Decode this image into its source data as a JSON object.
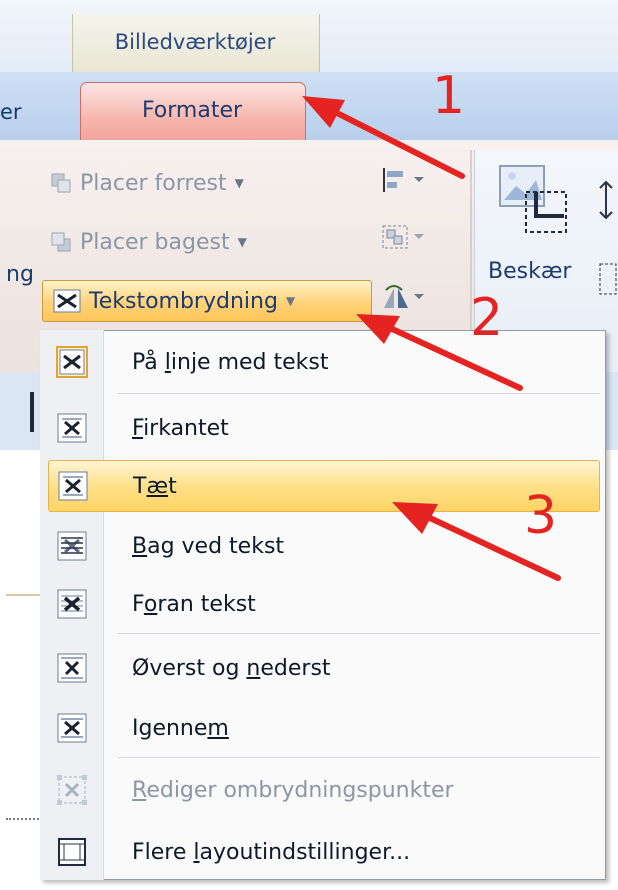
{
  "ribbon": {
    "contextual_group": "Billedværktøjer",
    "tab_left_partial": "er",
    "tab_active": "Formater",
    "left_partial": "ng",
    "placer_forrest": "Placer forrest",
    "placer_bagest": "Placer bagest",
    "tekstombrydning": "Tekstombrydning",
    "beskaer": "Beskær"
  },
  "menu": {
    "items": [
      {
        "pre": "På ",
        "key": "l",
        "post": "inje med tekst"
      },
      {
        "pre": "",
        "key": "F",
        "post": "irkantet"
      },
      {
        "pre": "T",
        "key": "æ",
        "post": "t"
      },
      {
        "pre": "",
        "key": "B",
        "post": "ag ved tekst"
      },
      {
        "pre": "F",
        "key": "o",
        "post": "ran tekst"
      },
      {
        "pre": "Øverst og ",
        "key": "n",
        "post": "ederst"
      },
      {
        "pre": "Igenne",
        "key": "m",
        "post": ""
      },
      {
        "pre": "",
        "key": "R",
        "post": "ediger ombrydningspunkter"
      },
      {
        "pre": "Flere ",
        "key": "l",
        "post": "ayoutindstillinger..."
      }
    ]
  },
  "annotations": {
    "n1": "1",
    "n2": "2",
    "n3": "3",
    "color": "#e52421"
  },
  "colors": {
    "tab_active": "#f7b5ae",
    "highlight": "#ffe08a",
    "text": "#1e3b6e"
  }
}
